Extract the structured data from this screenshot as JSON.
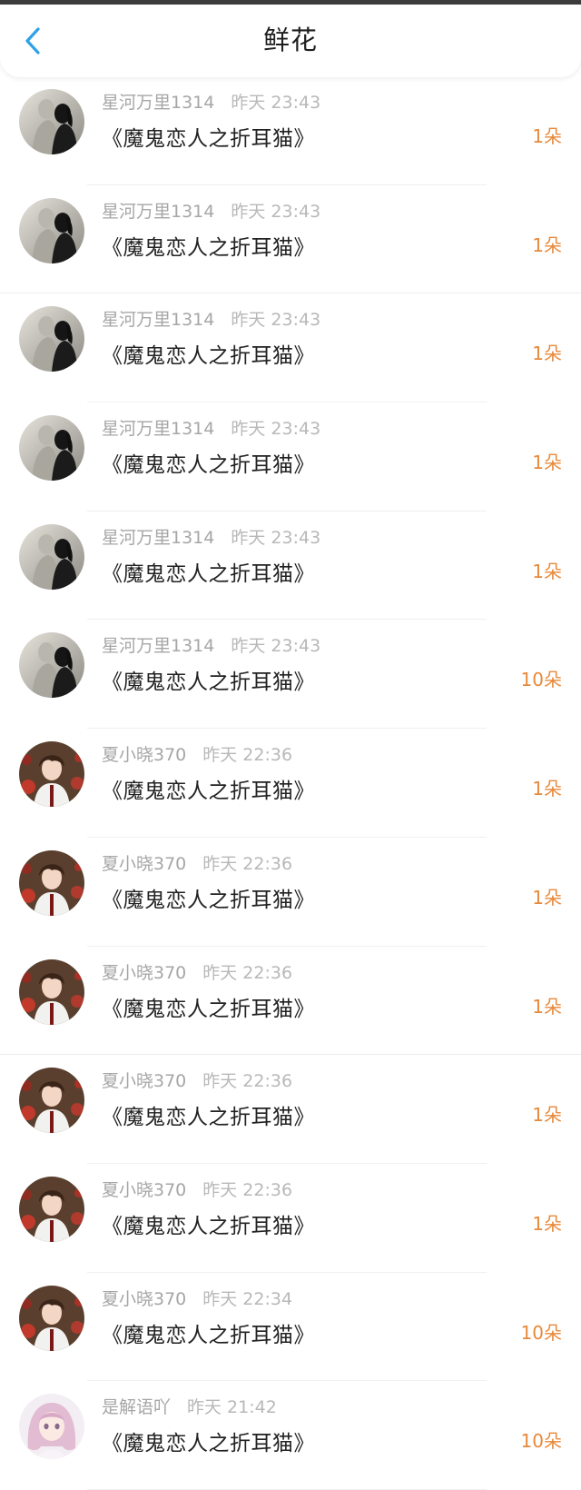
{
  "header": {
    "title": "鲜花"
  },
  "colors": {
    "accent": "#2ea2e6",
    "count": "#e8893a"
  },
  "rows": [
    {
      "username": "星河万里1314",
      "time": "昨天 23:43",
      "book": "《魔鬼恋人之折耳猫》",
      "count": "1朵",
      "avatar": "silhouette-couple"
    },
    {
      "username": "星河万里1314",
      "time": "昨天 23:43",
      "book": "《魔鬼恋人之折耳猫》",
      "count": "1朵",
      "avatar": "silhouette-couple"
    },
    {
      "username": "星河万里1314",
      "time": "昨天 23:43",
      "book": "《魔鬼恋人之折耳猫》",
      "count": "1朵",
      "avatar": "silhouette-couple"
    },
    {
      "username": "星河万里1314",
      "time": "昨天 23:43",
      "book": "《魔鬼恋人之折耳猫》",
      "count": "1朵",
      "avatar": "silhouette-couple"
    },
    {
      "username": "星河万里1314",
      "time": "昨天 23:43",
      "book": "《魔鬼恋人之折耳猫》",
      "count": "1朵",
      "avatar": "silhouette-couple"
    },
    {
      "username": "星河万里1314",
      "time": "昨天 23:43",
      "book": "《魔鬼恋人之折耳猫》",
      "count": "10朵",
      "avatar": "silhouette-couple"
    },
    {
      "username": "夏小晓370",
      "time": "昨天 22:36",
      "book": "《魔鬼恋人之折耳猫》",
      "count": "1朵",
      "avatar": "anime-boy"
    },
    {
      "username": "夏小晓370",
      "time": "昨天 22:36",
      "book": "《魔鬼恋人之折耳猫》",
      "count": "1朵",
      "avatar": "anime-boy"
    },
    {
      "username": "夏小晓370",
      "time": "昨天 22:36",
      "book": "《魔鬼恋人之折耳猫》",
      "count": "1朵",
      "avatar": "anime-boy"
    },
    {
      "username": "夏小晓370",
      "time": "昨天 22:36",
      "book": "《魔鬼恋人之折耳猫》",
      "count": "1朵",
      "avatar": "anime-boy"
    },
    {
      "username": "夏小晓370",
      "time": "昨天 22:36",
      "book": "《魔鬼恋人之折耳猫》",
      "count": "1朵",
      "avatar": "anime-boy"
    },
    {
      "username": "夏小晓370",
      "time": "昨天 22:34",
      "book": "《魔鬼恋人之折耳猫》",
      "count": "10朵",
      "avatar": "anime-boy"
    },
    {
      "username": "是解语吖",
      "time": "昨天 21:42",
      "book": "《魔鬼恋人之折耳猫》",
      "count": "10朵",
      "avatar": "anime-girl"
    }
  ]
}
